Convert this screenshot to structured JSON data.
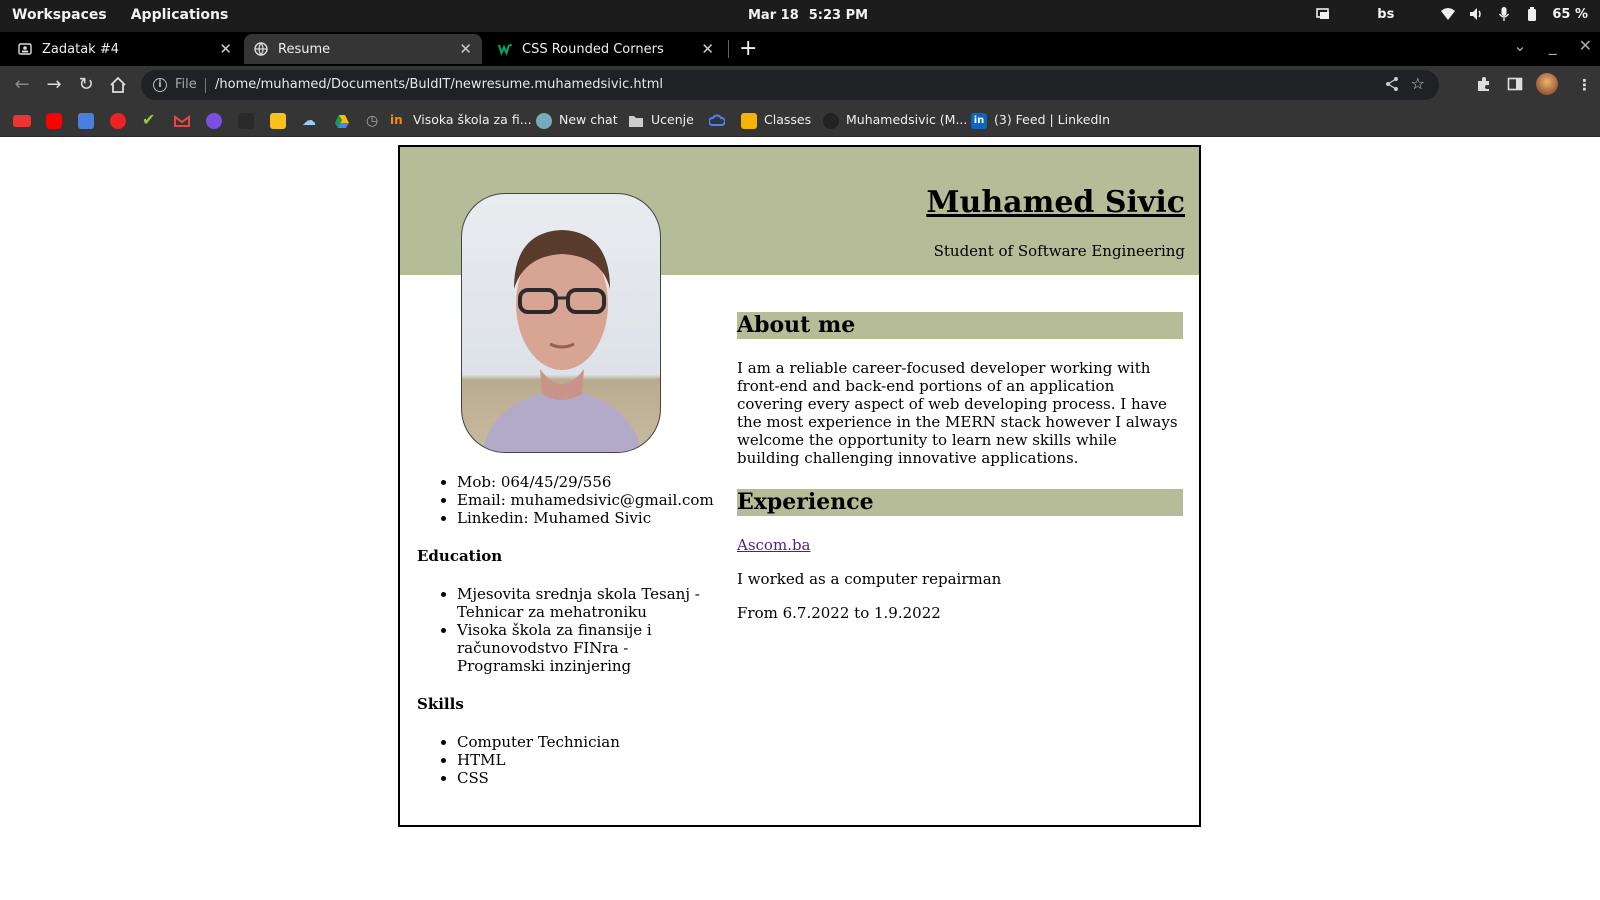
{
  "topbar": {
    "workspaces": "Workspaces",
    "applications": "Applications",
    "date": "Mar 18",
    "time": "5:23 PM",
    "keyboard_layout": "bs",
    "battery": "65 %"
  },
  "tabs": [
    {
      "title": "Zadatak #4",
      "favicon": "classroom-icon"
    },
    {
      "title": "Resume",
      "favicon": "globe-icon"
    },
    {
      "title": "CSS Rounded Corners",
      "favicon": "w3schools-icon"
    }
  ],
  "toolbar": {
    "scheme": "File",
    "url": "/home/muhamed/Documents/BuldIT/newresume.muhamedsivic.html"
  },
  "bookmarks": [
    {
      "label": "Visoka škola za fi..."
    },
    {
      "label": "New chat"
    },
    {
      "label": "Ucenje"
    },
    {
      "label": "Classes"
    },
    {
      "label": "Muhamedsivic (M..."
    },
    {
      "label": "(3) Feed | LinkedIn"
    }
  ],
  "resume": {
    "name": "Muhamed Sivic",
    "subtitle": "Student of Software Engineering",
    "contact": [
      "Mob: 064/45/29/556",
      "Email: muhamedsivic@gmail.com",
      "Linkedin: Muhamed Sivic"
    ],
    "education_heading": "Education",
    "education": [
      "Mjesovita srednja skola Tesanj - Tehnicar za mehatroniku",
      "Visoka škola za finansije i računovodstvo FINra - Programski inzinjering"
    ],
    "skills_heading": "Skills",
    "skills": [
      "Computer Technician",
      "HTML",
      "CSS"
    ],
    "about_heading": "About me",
    "about_text": "I am a reliable career-focused developer working with front-end and back-end portions of an application covering every aspect of web developing process. I have the most experience in the MERN stack however I always welcome the opportunity to learn new skills while building challenging innovative applications.",
    "experience_heading": "Experience",
    "experience_company": "Ascom.ba",
    "experience_role": "I worked as a computer repairman",
    "experience_dates": "From 6.7.2022 to 1.9.2022"
  },
  "colors": {
    "banner": "#b6bc98",
    "visited_link": "#551a8b",
    "browser_chrome": "#353535"
  }
}
